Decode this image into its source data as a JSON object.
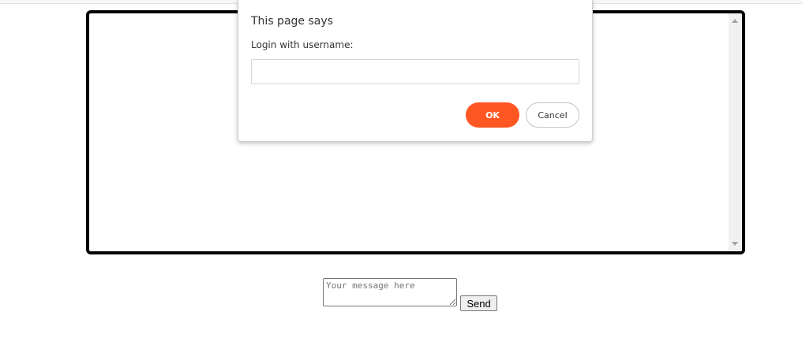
{
  "dialog": {
    "title": "This page says",
    "message": "Login with username:",
    "input_value": "",
    "ok_label": "OK",
    "cancel_label": "Cancel"
  },
  "composer": {
    "placeholder": "Your message here",
    "send_label": "Send"
  },
  "colors": {
    "ok_button": "#ff5722",
    "chat_border": "#000000"
  }
}
